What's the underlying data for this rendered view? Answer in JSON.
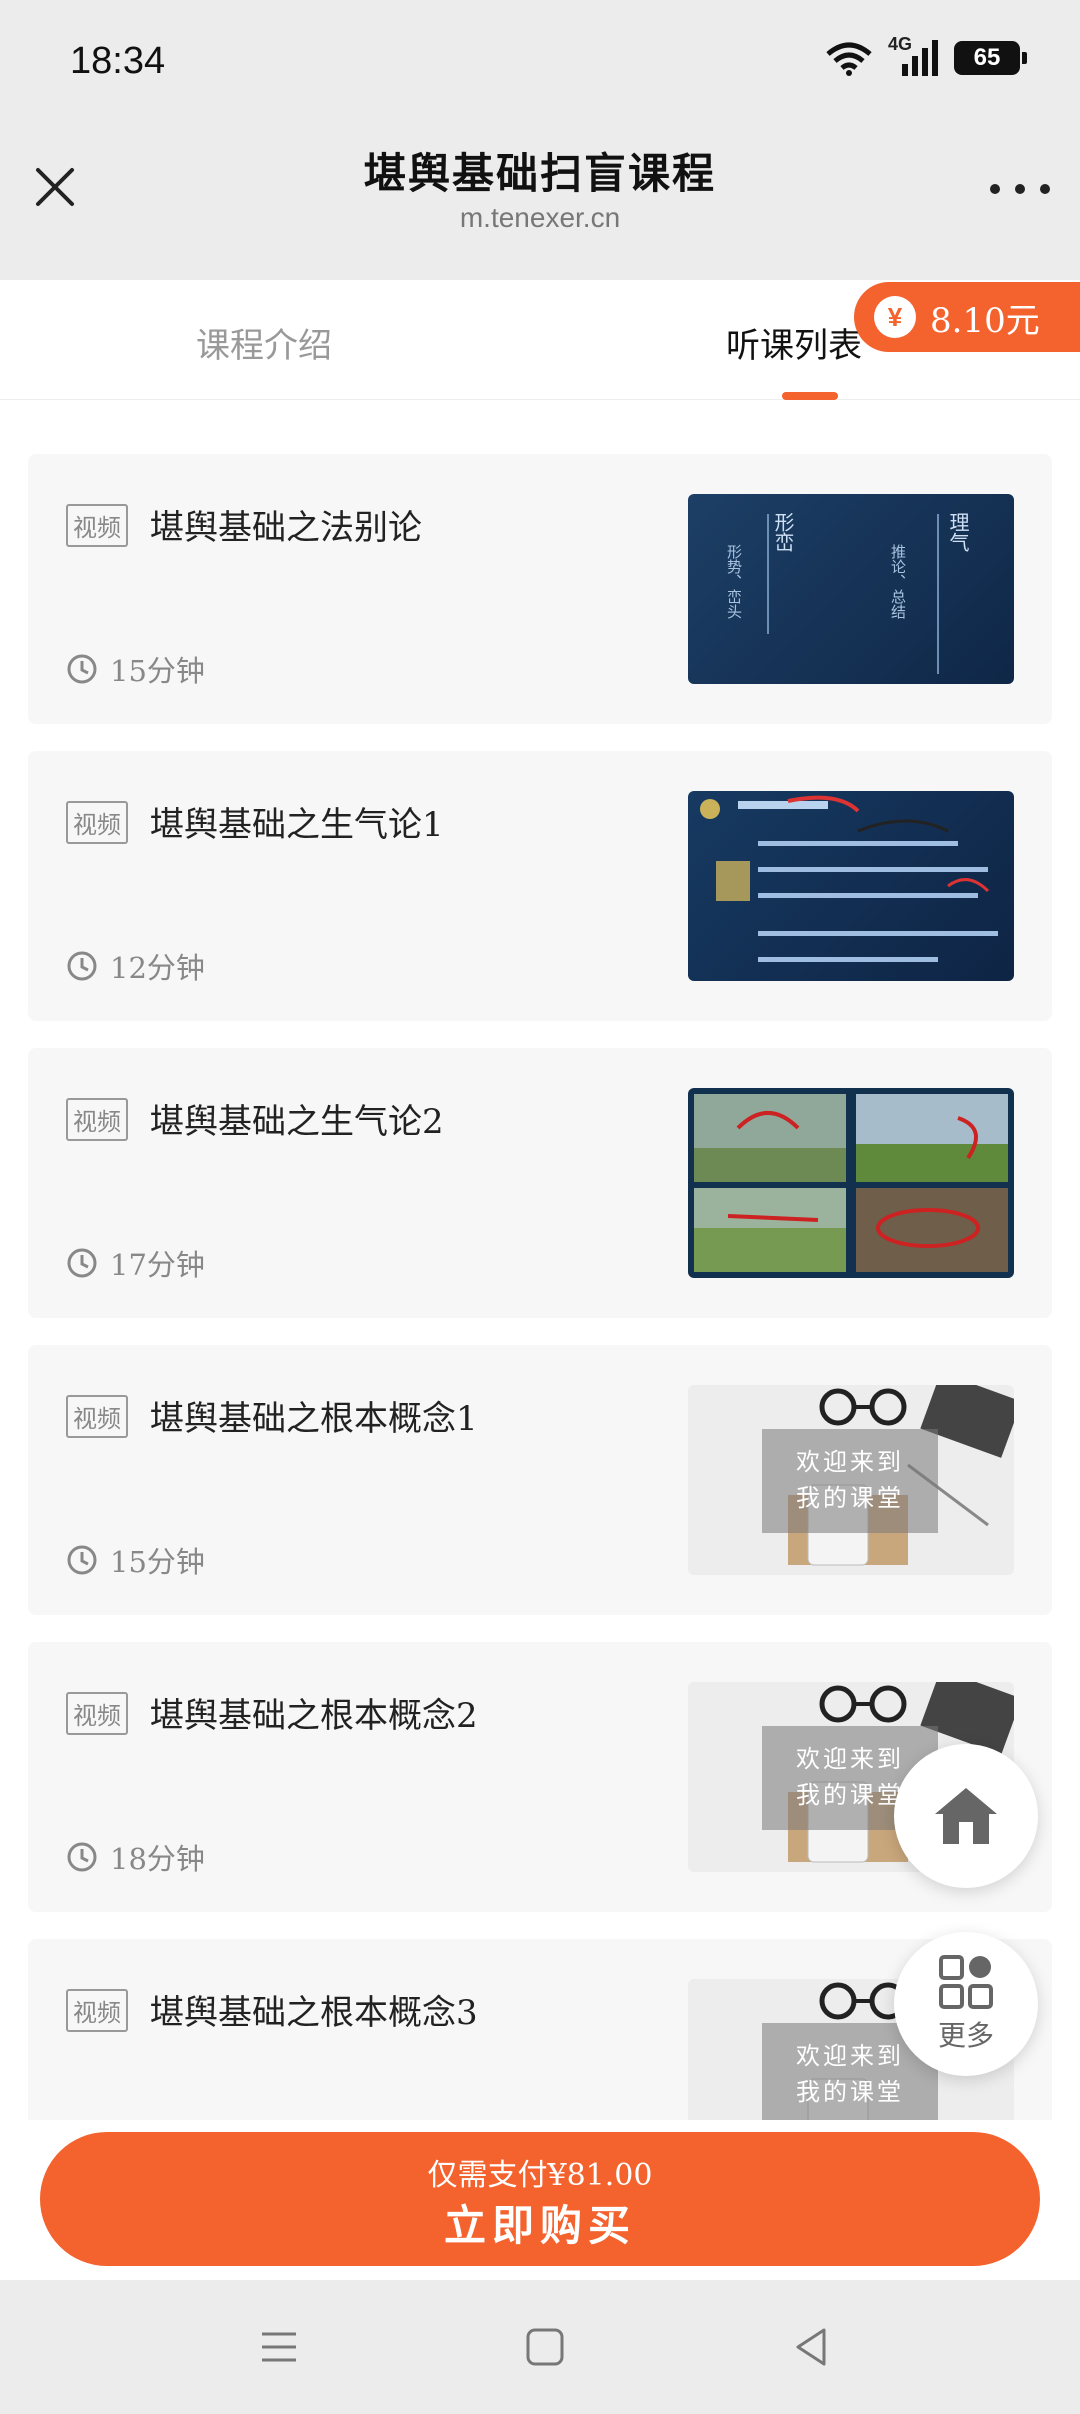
{
  "status_bar": {
    "time": "18:34",
    "network": "4G",
    "battery": "65"
  },
  "header": {
    "title": "堪舆基础扫盲课程",
    "url": "m.tenexer.cn"
  },
  "tabs": [
    {
      "label": "课程介绍"
    },
    {
      "label": "听课列表"
    }
  ],
  "price_badge": {
    "label": "8.10元",
    "icon": "yen-coin-icon"
  },
  "lessons": [
    {
      "tag": "视频",
      "title": "堪舆基础之法别论",
      "duration": "15分钟",
      "thumb": {
        "style": "dark-blue-slide",
        "text": [
          "形峦",
          "形势、峦头",
          "理气",
          "推论、总结"
        ]
      }
    },
    {
      "tag": "视频",
      "title": "堪舆基础之生气论1",
      "duration": "12分钟",
      "thumb": {
        "style": "dark-blue-text-slide"
      }
    },
    {
      "tag": "视频",
      "title": "堪舆基础之生气论2",
      "duration": "17分钟",
      "thumb": {
        "style": "landscape-grid"
      }
    },
    {
      "tag": "视频",
      "title": "堪舆基础之根本概念1",
      "duration": "15分钟",
      "thumb": {
        "style": "desk-welcome",
        "text": [
          "欢迎来到",
          "我的课堂"
        ]
      }
    },
    {
      "tag": "视频",
      "title": "堪舆基础之根本概念2",
      "duration": "18分钟",
      "thumb": {
        "style": "desk-welcome",
        "text": [
          "欢迎来到",
          "我的课堂"
        ]
      }
    },
    {
      "tag": "视频",
      "title": "堪舆基础之根本概念3",
      "duration": "",
      "thumb": {
        "style": "desk-welcome",
        "text": [
          "欢迎来到",
          "我的课堂"
        ]
      }
    }
  ],
  "floating": {
    "home_icon": "home-icon",
    "more_label": "更多"
  },
  "buy": {
    "sub_label": "仅需支付¥81.00",
    "main_label": "立即购买"
  },
  "colors": {
    "accent": "#f4622d"
  }
}
